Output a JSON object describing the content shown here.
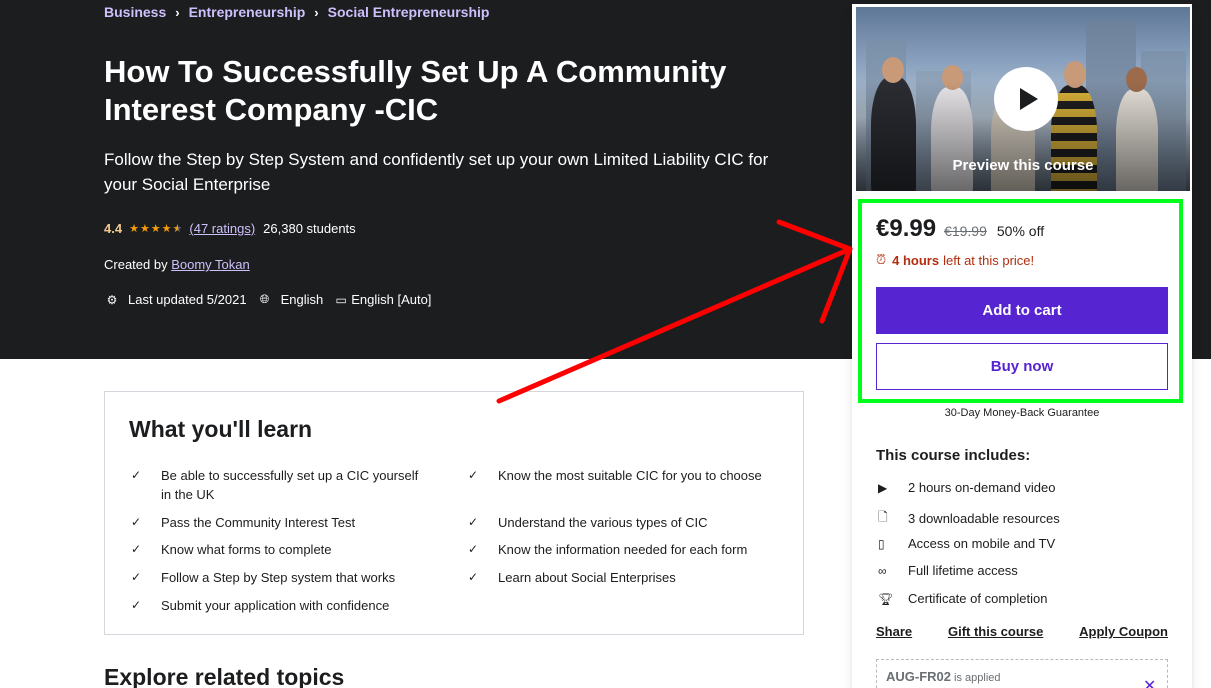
{
  "breadcrumb": [
    "Business",
    "Entrepreneurship",
    "Social Entrepreneurship"
  ],
  "course": {
    "title": "How To Successfully Set Up A Community Interest Company -CIC",
    "subtitle": "Follow the Step by Step System and confidently set up your own Limited Liability CIC for your Social Enterprise",
    "rating": "4.4",
    "stars": 4.4,
    "ratings_link": "(47 ratings)",
    "students": "26,380 students",
    "created_by_label": "Created by",
    "author": "Boomy Tokan",
    "last_updated": "Last updated 5/2021",
    "language": "English",
    "captions": "English [Auto]"
  },
  "learn": {
    "heading": "What you'll learn",
    "items": [
      "Be able to successfully set up a CIC yourself in the UK",
      "Know the most suitable CIC for you to choose",
      "Pass the Community Interest Test",
      "Understand the various types of CIC",
      "Know what forms to complete",
      "Know the information needed for each form",
      "Follow a Step by Step system that works",
      "Learn about Social Enterprises",
      "Submit your application with confidence"
    ]
  },
  "related_heading": "Explore related topics",
  "sidebar": {
    "preview_label": "Preview this course",
    "price": "€9.99",
    "original_price": "€19.99",
    "discount": "50% off",
    "timer_bold": "4 hours",
    "timer_rest": "left at this price!",
    "add_to_cart": "Add to cart",
    "buy_now": "Buy now",
    "guarantee": "30-Day Money-Back Guarantee",
    "includes_heading": "This course includes:",
    "includes": [
      {
        "icon": "video-icon",
        "text": "2 hours on-demand video"
      },
      {
        "icon": "file-download-icon",
        "text": "3 downloadable resources"
      },
      {
        "icon": "mobile-icon",
        "text": "Access on mobile and TV"
      },
      {
        "icon": "infinity-icon",
        "text": "Full lifetime access"
      },
      {
        "icon": "trophy-icon",
        "text": "Certificate of completion"
      }
    ],
    "links": [
      "Share",
      "Gift this course",
      "Apply Coupon"
    ],
    "coupon_code": "AUG-FR02",
    "coupon_status": "is applied"
  },
  "colors": {
    "hero_bg": "#1c1d1f",
    "accent_purple": "#5624d0",
    "link_purple": "#cec0fc",
    "star_orange": "#f69c08",
    "alert_red": "#b32d0f",
    "highlight_green": "#00ff1a",
    "annotation_red": "#ff0000"
  }
}
